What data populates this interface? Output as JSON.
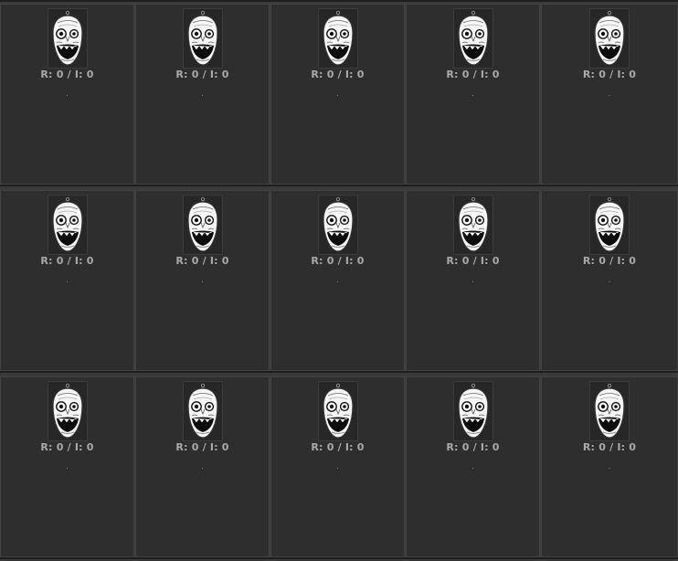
{
  "colors": {
    "page_background": "#3a3a3a",
    "card_background": "#2e2e2e",
    "card_border": "#434343",
    "stats_text": "#a9a9a9"
  },
  "thumbnail_icon": "troll-face-mask-icon",
  "rows": [
    {
      "cards": [
        {
          "stats": "R: 0 / I: 0",
          "caption": "."
        },
        {
          "stats": "R: 0 / I: 0",
          "caption": "."
        },
        {
          "stats": "R: 0 / I: 0",
          "caption": "."
        },
        {
          "stats": "R: 0 / I: 0",
          "caption": "."
        },
        {
          "stats": "R: 0 / I: 0",
          "caption": "."
        }
      ]
    },
    {
      "cards": [
        {
          "stats": "R: 0 / I: 0",
          "caption": "."
        },
        {
          "stats": "R: 0 / I: 0",
          "caption": "."
        },
        {
          "stats": "R: 0 / I: 0",
          "caption": "."
        },
        {
          "stats": "R: 0 / I: 0",
          "caption": "."
        },
        {
          "stats": "R: 0 / I: 0",
          "caption": "."
        }
      ]
    },
    {
      "cards": [
        {
          "stats": "R: 0 / I: 0",
          "caption": "."
        },
        {
          "stats": "R: 0 / I: 0",
          "caption": "."
        },
        {
          "stats": "R: 0 / I: 0",
          "caption": "."
        },
        {
          "stats": "R: 0 / I: 0",
          "caption": "."
        },
        {
          "stats": "R: 0 / I: 0",
          "caption": "."
        }
      ]
    }
  ]
}
